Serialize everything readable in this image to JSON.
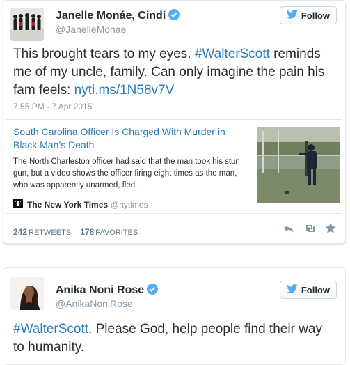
{
  "tweet1": {
    "name": "Janelle Monáe, Cindi",
    "handle": "@JanelleMonae",
    "follow_label": "Follow",
    "text_before": "This brought tears to my eyes. ",
    "hashtag": "#WalterScott",
    "text_middle": " reminds me of my uncle, family. Can only imagine the pain his fam feels: ",
    "link": "nyti.ms/1N58v7V",
    "timestamp": "7:55 PM - 7 Apr 2015",
    "card": {
      "title": "South Carolina Officer Is Charged With Murder in Black Man’s Death",
      "description": "The North Charleston officer had said that the man took his stun gun, but a video shows the officer firing eight times as the man, who was apparently unarmed, fled.",
      "source_name": "The New York Times",
      "source_handle": "@nytimes"
    },
    "retweets_count": "242",
    "retweets_label": "RETWEETS",
    "favorites_count": "178",
    "favorites_label": "FAVORITES"
  },
  "tweet2": {
    "name": "Anika Noni Rose",
    "handle": "@AnikaNoniRose",
    "follow_label": "Follow",
    "hashtag": "#WalterScott",
    "text_after": ". Please God, help people find their way to humanity."
  },
  "colors": {
    "link": "#2b7bb9",
    "verified": "#55acee",
    "twitter_bird": "#55acee",
    "muted": "#8899a6"
  },
  "icons": [
    "verified-badge-icon",
    "twitter-bird-icon",
    "reply-icon",
    "retweet-icon",
    "favorite-star-icon",
    "nyt-logo-icon"
  ]
}
